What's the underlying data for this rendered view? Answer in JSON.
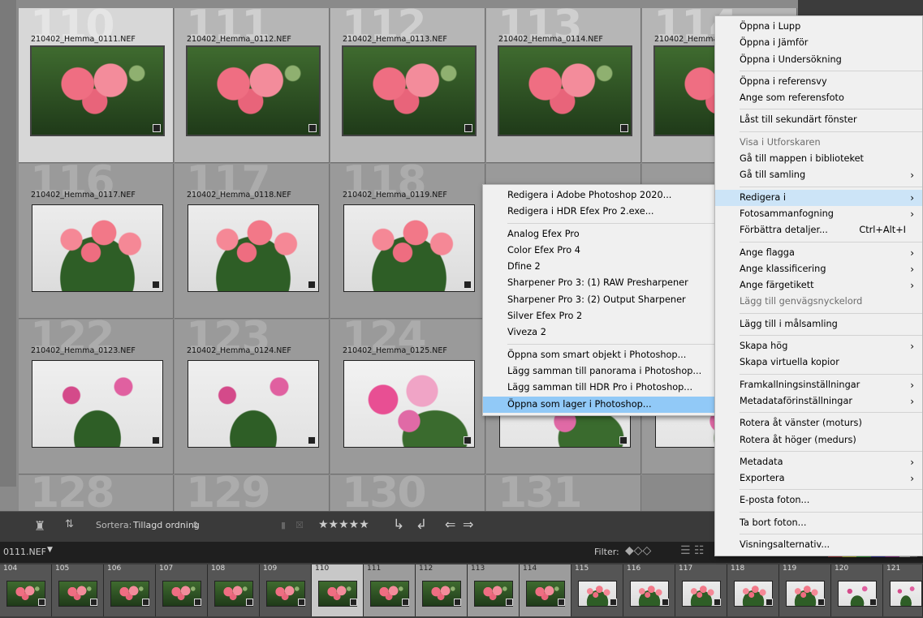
{
  "grid": {
    "row1": [
      {
        "num": "110",
        "name": "210402_Hemma_0111.NEF"
      },
      {
        "num": "111",
        "name": "210402_Hemma_0112.NEF"
      },
      {
        "num": "112",
        "name": "210402_Hemma_0113.NEF"
      },
      {
        "num": "113",
        "name": "210402_Hemma_0114.NEF"
      },
      {
        "num": "114",
        "name": "210402_Hemma_0115.NEF"
      }
    ],
    "row2": [
      {
        "num": "116",
        "name": "210402_Hemma_0117.NEF"
      },
      {
        "num": "117",
        "name": "210402_Hemma_0118.NEF"
      },
      {
        "num": "118",
        "name": "210402_Hemma_0119.NEF"
      }
    ],
    "row3": [
      {
        "num": "122",
        "name": "210402_Hemma_0123.NEF"
      },
      {
        "num": "123",
        "name": "210402_Hemma_0124.NEF"
      },
      {
        "num": "124",
        "name": "210402_Hemma_0125.NEF"
      }
    ],
    "row4": [
      "128",
      "129",
      "130",
      "131"
    ]
  },
  "toolbar": {
    "sort_label": "Sortera:",
    "sort_value": "Tillagd ordning",
    "stars": "★★★★★"
  },
  "filmbar": {
    "filename": "0111.NEF",
    "filter_label": "Filter:",
    "rating": "≥ ★★★★★"
  },
  "filmstrip": [
    "104",
    "105",
    "106",
    "107",
    "108",
    "109",
    "110",
    "111",
    "112",
    "113",
    "114",
    "115",
    "116",
    "117",
    "118",
    "119",
    "120",
    "121"
  ],
  "context_menu": {
    "items": [
      {
        "label": "Öppna i Lupp"
      },
      {
        "label": "Öppna i Jämför"
      },
      {
        "label": "Öppna i Undersökning"
      },
      {
        "sep": true
      },
      {
        "label": "Öppna i referensvy"
      },
      {
        "label": "Ange som referensfoto"
      },
      {
        "sep": true
      },
      {
        "label": "Låst till sekundärt fönster"
      },
      {
        "sep": true
      },
      {
        "label": "Visa i Utforskaren",
        "disabled": true
      },
      {
        "label": "Gå till mappen i biblioteket"
      },
      {
        "label": "Gå till samling",
        "arrow": true
      },
      {
        "sep": true
      },
      {
        "label": "Redigera i",
        "arrow": true,
        "highlight": true
      },
      {
        "label": "Fotosammanfogning",
        "arrow": true
      },
      {
        "label": "Förbättra detaljer...",
        "shortcut": "Ctrl+Alt+I"
      },
      {
        "sep": true
      },
      {
        "label": "Ange flagga",
        "arrow": true
      },
      {
        "label": "Ange klassificering",
        "arrow": true
      },
      {
        "label": "Ange färgetikett",
        "arrow": true
      },
      {
        "label": "Lägg till genvägsnyckelord",
        "disabled": true
      },
      {
        "sep": true
      },
      {
        "label": "Lägg till i målsamling"
      },
      {
        "sep": true
      },
      {
        "label": "Skapa hög",
        "arrow": true
      },
      {
        "label": "Skapa virtuella kopior"
      },
      {
        "sep": true
      },
      {
        "label": "Framkallningsinställningar",
        "arrow": true
      },
      {
        "label": "Metadataförinställningar",
        "arrow": true
      },
      {
        "sep": true
      },
      {
        "label": "Rotera åt vänster (moturs)"
      },
      {
        "label": "Rotera åt höger (medurs)"
      },
      {
        "sep": true
      },
      {
        "label": "Metadata",
        "arrow": true
      },
      {
        "label": "Exportera",
        "arrow": true
      },
      {
        "sep": true
      },
      {
        "label": "E-posta foton..."
      },
      {
        "sep": true
      },
      {
        "label": "Ta bort foton..."
      },
      {
        "sep": true
      },
      {
        "label": "Visningsalternativ..."
      }
    ]
  },
  "submenu": {
    "items": [
      {
        "label": "Redigera i Adobe Photoshop 2020..."
      },
      {
        "label": "Redigera i HDR Efex Pro 2.exe..."
      },
      {
        "sep": true
      },
      {
        "label": "Analog Efex Pro"
      },
      {
        "label": "Color Efex Pro 4"
      },
      {
        "label": "Dfine 2"
      },
      {
        "label": "Sharpener Pro 3: (1) RAW Presharpener"
      },
      {
        "label": "Sharpener Pro 3: (2) Output Sharpener"
      },
      {
        "label": "Silver Efex Pro 2"
      },
      {
        "label": "Viveza 2"
      },
      {
        "sep": true
      },
      {
        "label": "Öppna som smart objekt i Photoshop..."
      },
      {
        "label": "Lägg samman till panorama i Photoshop..."
      },
      {
        "label": "Lägg samman till HDR Pro i Photoshop..."
      },
      {
        "label": "Öppna som lager i Photoshop...",
        "highlight": true
      }
    ]
  }
}
